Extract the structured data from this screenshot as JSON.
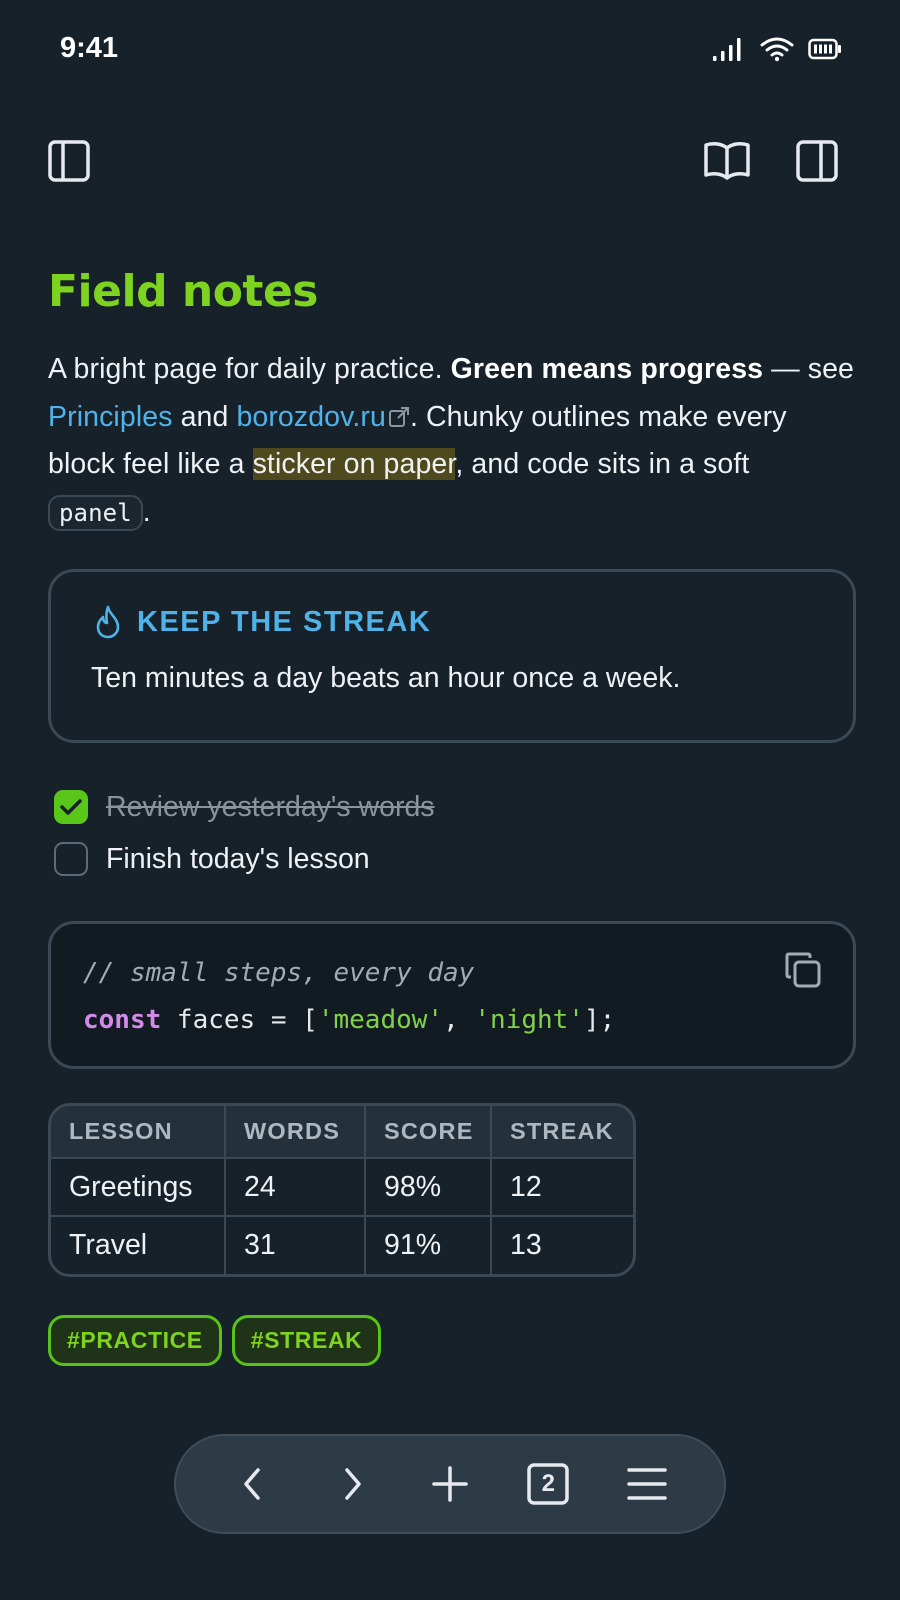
{
  "status": {
    "time": "9:41"
  },
  "toolbar": {
    "left_icon": "sidebar-left-icon",
    "reader_icon": "book-open-icon",
    "right_icon": "sidebar-right-icon"
  },
  "page": {
    "title": "Field notes",
    "intro": {
      "t1": "A bright page for daily practice. ",
      "bold": "Green means progress",
      "t2": " — see ",
      "link1": "Principles",
      "t3": " and ",
      "link2": "borozdov.ru",
      "t4": ". Chunky outlines make every block feel like a ",
      "highlight": "sticker on paper",
      "t5": ", and code sits in a soft ",
      "code": "panel",
      "t6": "."
    }
  },
  "callout": {
    "icon": "flame-icon",
    "title": "KEEP THE STREAK",
    "body": "Ten minutes a day beats an hour once a week."
  },
  "tasks": [
    {
      "label": "Review yesterday's words",
      "checked": true
    },
    {
      "label": "Finish today's lesson",
      "checked": false
    }
  ],
  "code": {
    "comment": "// small steps, every day",
    "keyword": "const",
    "ident": " faces = [",
    "str1": "'meadow'",
    "sep": ", ",
    "str2": "'night'",
    "end": "];"
  },
  "table": {
    "headers": [
      "LESSON",
      "WORDS",
      "SCORE",
      "STREAK"
    ],
    "rows": [
      [
        "Greetings",
        "24",
        "98%",
        "12"
      ],
      [
        "Travel",
        "31",
        "91%",
        "13"
      ]
    ]
  },
  "tags": [
    "#PRACTICE",
    "#STREAK"
  ],
  "bottom_nav": {
    "tab_count": "2",
    "icons": [
      "chevron-left-icon",
      "chevron-right-icon",
      "plus-icon",
      "tabs-icon",
      "menu-icon"
    ]
  },
  "colors": {
    "background": "#17212a",
    "accent_green": "#7dd320",
    "link_blue": "#4fb3ea",
    "border": "#3b4954"
  }
}
